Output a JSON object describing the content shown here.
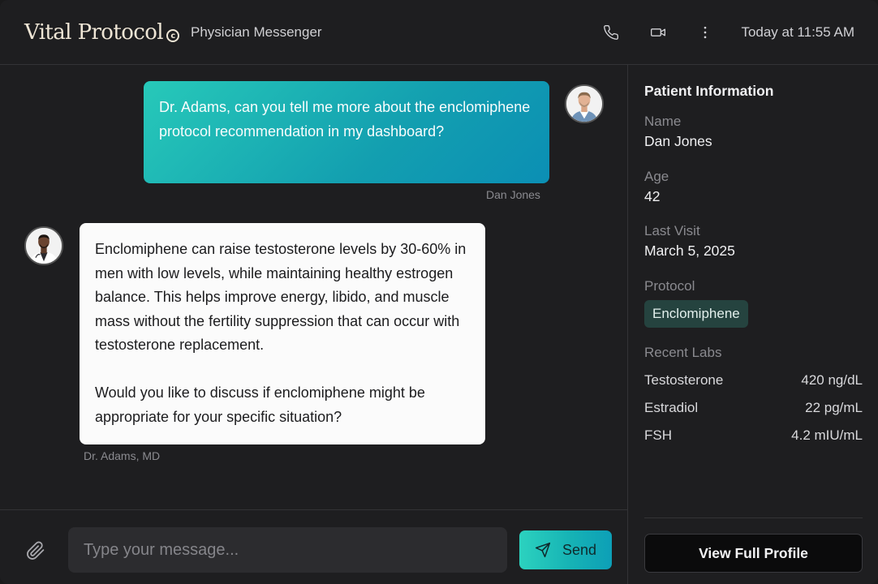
{
  "header": {
    "logo_text": "Vital Protocol",
    "logo_mark": "c",
    "subtitle": "Physician Messenger",
    "timestamp": "Today at 11:55 AM",
    "icons": [
      "phone-icon",
      "video-camera-icon",
      "more-vertical-icon"
    ]
  },
  "messages": [
    {
      "from": "patient",
      "text": "Dr. Adams, can you tell me more about the enclomiphene protocol recommendation in my dashboard?",
      "sender": "Dan Jones"
    },
    {
      "from": "doctor",
      "paragraphs": [
        "Enclomiphene can raise testosterone levels by 30-60% in men with low levels, while maintaining healthy estrogen balance. This helps improve energy, libido, and muscle mass without the fertility suppression that can occur with testosterone replacement.",
        "Would you like to discuss if enclomiphene might be appropriate for your specific situation?"
      ],
      "sender": "Dr. Adams, MD"
    }
  ],
  "composer": {
    "placeholder": "Type your message...",
    "send_label": "Send"
  },
  "panel": {
    "title": "Patient Information",
    "name_label": "Name",
    "name_value": "Dan Jones",
    "age_label": "Age",
    "age_value": "42",
    "last_visit_label": "Last Visit",
    "last_visit_value": "March 5, 2025",
    "protocol_label": "Protocol",
    "protocol_value": "Enclomiphene",
    "labs_label": "Recent Labs",
    "labs": [
      {
        "name": "Testosterone",
        "value": "420 ng/dL"
      },
      {
        "name": "Estradiol",
        "value": "22 pg/mL"
      },
      {
        "name": "FSH",
        "value": "4.2 mIU/mL"
      }
    ],
    "profile_button": "View Full Profile"
  },
  "colors": {
    "accent_start": "#2cd2bf",
    "accent_end": "#0d9fb7",
    "background": "#1e1e20",
    "protocol_chip": "#25433f"
  }
}
